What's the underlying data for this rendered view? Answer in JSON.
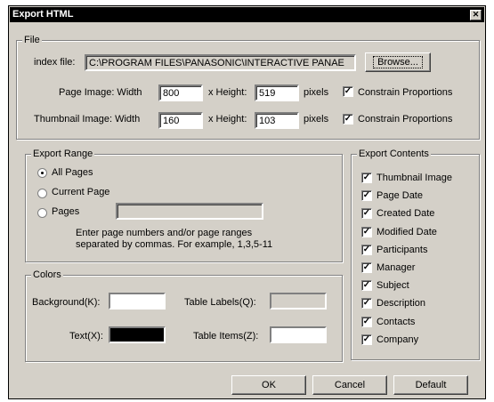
{
  "window": {
    "title": "Export HTML",
    "close_icon": "close-icon"
  },
  "file_group": {
    "legend": "File",
    "index_label": "index file:",
    "index_value": "C:\\PROGRAM FILES\\PANASONIC\\INTERACTIVE PANAE",
    "browse_label": "Browse...",
    "page_image_label": "Page Image: Width",
    "page_width": "800",
    "page_height_label": "x Height:",
    "page_height": "519",
    "page_pixels": "pixels",
    "page_constrain": "Constrain Proportions",
    "page_constrain_checked": true,
    "thumb_label": "Thumbnail Image: Width",
    "thumb_width": "160",
    "thumb_height_label": "x Height:",
    "thumb_height": "103",
    "thumb_pixels": "pixels",
    "thumb_constrain": "Constrain Proportions",
    "thumb_constrain_checked": true
  },
  "range_group": {
    "legend": "Export Range",
    "options": [
      "All Pages",
      "Current Page",
      "Pages"
    ],
    "selected": "All Pages",
    "pages_value": "",
    "hint_line1": "Enter page numbers and/or page ranges",
    "hint_line2": "separated by commas.  For example, 1,3,5-11"
  },
  "colors_group": {
    "legend": "Colors",
    "background_label": "Background(K):",
    "background_color": "#ffffff",
    "table_labels_label": "Table Labels(Q):",
    "table_labels_color": "#d4d0c8",
    "text_label": "Text(X):",
    "text_color": "#000000",
    "table_items_label": "Table Items(Z):",
    "table_items_color": "#ffffff"
  },
  "contents_group": {
    "legend": "Export Contents",
    "items": [
      {
        "label": "Thumbnail Image",
        "checked": true
      },
      {
        "label": "Page Date",
        "checked": true
      },
      {
        "label": "Created Date",
        "checked": true
      },
      {
        "label": "Modified Date",
        "checked": true
      },
      {
        "label": "Participants",
        "checked": true
      },
      {
        "label": "Manager",
        "checked": true
      },
      {
        "label": "Subject",
        "checked": true
      },
      {
        "label": "Description",
        "checked": true
      },
      {
        "label": "Contacts",
        "checked": true
      },
      {
        "label": "Company",
        "checked": true
      }
    ]
  },
  "buttons": {
    "ok": "OK",
    "cancel": "Cancel",
    "default": "Default"
  }
}
